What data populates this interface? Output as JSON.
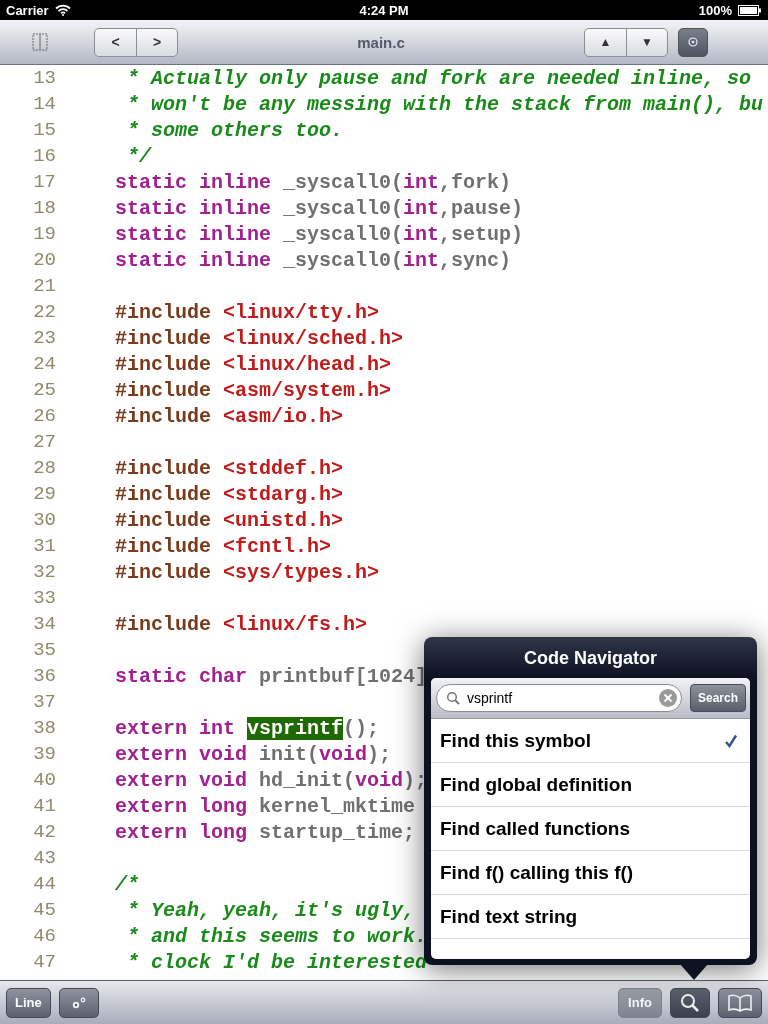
{
  "status_bar": {
    "carrier": "Carrier",
    "time": "4:24 PM",
    "battery": "100%"
  },
  "nav_bar": {
    "title": "main.c",
    "history_buttons": [
      "<",
      ">"
    ],
    "scroll_buttons": [
      "▲",
      "▼"
    ],
    "target_button_selected": true
  },
  "code_lines": [
    {
      "number": "13",
      "tokens": [
        {
          "kind": "comment",
          "text": " * Actually only pause and fork are needed inline, so"
        }
      ]
    },
    {
      "number": "14",
      "tokens": [
        {
          "kind": "comment",
          "text": " * won't be any messing with the stack from main(), bu"
        }
      ]
    },
    {
      "number": "15",
      "tokens": [
        {
          "kind": "comment",
          "text": " * some others too."
        }
      ]
    },
    {
      "number": "16",
      "tokens": [
        {
          "kind": "comment",
          "text": " */"
        }
      ]
    },
    {
      "number": "17",
      "tokens": [
        {
          "kind": "keyword",
          "text": "static inline "
        },
        {
          "kind": "plain",
          "text": "_syscall0("
        },
        {
          "kind": "keyword",
          "text": "int"
        },
        {
          "kind": "plain",
          "text": ",fork)"
        }
      ]
    },
    {
      "number": "18",
      "tokens": [
        {
          "kind": "keyword",
          "text": "static inline "
        },
        {
          "kind": "plain",
          "text": "_syscall0("
        },
        {
          "kind": "keyword",
          "text": "int"
        },
        {
          "kind": "plain",
          "text": ",pause)"
        }
      ]
    },
    {
      "number": "19",
      "tokens": [
        {
          "kind": "keyword",
          "text": "static inline "
        },
        {
          "kind": "plain",
          "text": "_syscall0("
        },
        {
          "kind": "keyword",
          "text": "int"
        },
        {
          "kind": "plain",
          "text": ",setup)"
        }
      ]
    },
    {
      "number": "20",
      "tokens": [
        {
          "kind": "keyword",
          "text": "static inline "
        },
        {
          "kind": "plain",
          "text": "_syscall0("
        },
        {
          "kind": "keyword",
          "text": "int"
        },
        {
          "kind": "plain",
          "text": ",sync)"
        }
      ]
    },
    {
      "number": "21"
    },
    {
      "number": "22",
      "tokens": [
        {
          "kind": "directive",
          "text": "#include "
        },
        {
          "kind": "header",
          "text": "<linux/tty.h>"
        }
      ]
    },
    {
      "number": "23",
      "tokens": [
        {
          "kind": "directive",
          "text": "#include "
        },
        {
          "kind": "header",
          "text": "<linux/sched.h>"
        }
      ]
    },
    {
      "number": "24",
      "tokens": [
        {
          "kind": "directive",
          "text": "#include "
        },
        {
          "kind": "header",
          "text": "<linux/head.h>"
        }
      ]
    },
    {
      "number": "25",
      "tokens": [
        {
          "kind": "directive",
          "text": "#include "
        },
        {
          "kind": "header",
          "text": "<asm/system.h>"
        }
      ]
    },
    {
      "number": "26",
      "tokens": [
        {
          "kind": "directive",
          "text": "#include "
        },
        {
          "kind": "header",
          "text": "<asm/io.h>"
        }
      ]
    },
    {
      "number": "27"
    },
    {
      "number": "28",
      "tokens": [
        {
          "kind": "directive",
          "text": "#include "
        },
        {
          "kind": "header",
          "text": "<stddef.h>"
        }
      ]
    },
    {
      "number": "29",
      "tokens": [
        {
          "kind": "directive",
          "text": "#include "
        },
        {
          "kind": "header",
          "text": "<stdarg.h>"
        }
      ]
    },
    {
      "number": "30",
      "tokens": [
        {
          "kind": "directive",
          "text": "#include "
        },
        {
          "kind": "header",
          "text": "<unistd.h>"
        }
      ]
    },
    {
      "number": "31",
      "tokens": [
        {
          "kind": "directive",
          "text": "#include "
        },
        {
          "kind": "header",
          "text": "<fcntl.h>"
        }
      ]
    },
    {
      "number": "32",
      "tokens": [
        {
          "kind": "directive",
          "text": "#include "
        },
        {
          "kind": "header",
          "text": "<sys/types.h>"
        }
      ]
    },
    {
      "number": "33"
    },
    {
      "number": "34",
      "tokens": [
        {
          "kind": "directive",
          "text": "#include "
        },
        {
          "kind": "header",
          "text": "<linux/fs.h>"
        }
      ]
    },
    {
      "number": "35"
    },
    {
      "number": "36",
      "tokens": [
        {
          "kind": "keyword",
          "text": "static char "
        },
        {
          "kind": "plain",
          "text": "printbuf[1024]"
        }
      ]
    },
    {
      "number": "37"
    },
    {
      "number": "38",
      "tokens": [
        {
          "kind": "keyword",
          "text": "extern int "
        },
        {
          "kind": "match",
          "text": "vsprintf"
        },
        {
          "kind": "plain",
          "text": "();"
        }
      ]
    },
    {
      "number": "39",
      "tokens": [
        {
          "kind": "keyword",
          "text": "extern void "
        },
        {
          "kind": "plain",
          "text": "init("
        },
        {
          "kind": "keyword",
          "text": "void"
        },
        {
          "kind": "plain",
          "text": ");"
        }
      ]
    },
    {
      "number": "40",
      "tokens": [
        {
          "kind": "keyword",
          "text": "extern void "
        },
        {
          "kind": "plain",
          "text": "hd_init("
        },
        {
          "kind": "keyword",
          "text": "void"
        },
        {
          "kind": "plain",
          "text": ");"
        }
      ]
    },
    {
      "number": "41",
      "tokens": [
        {
          "kind": "keyword",
          "text": "extern long "
        },
        {
          "kind": "plain",
          "text": "kernel_mktime"
        }
      ]
    },
    {
      "number": "42",
      "tokens": [
        {
          "kind": "keyword",
          "text": "extern long "
        },
        {
          "kind": "plain",
          "text": "startup_time;"
        }
      ]
    },
    {
      "number": "43"
    },
    {
      "number": "44",
      "tokens": [
        {
          "kind": "comment",
          "text": "/*"
        }
      ]
    },
    {
      "number": "45",
      "tokens": [
        {
          "kind": "comment",
          "text": " * Yeah, yeah, it's ugly,"
        }
      ]
    },
    {
      "number": "46",
      "tokens": [
        {
          "kind": "comment",
          "text": " * and this seems to work."
        }
      ]
    },
    {
      "number": "47",
      "tokens": [
        {
          "kind": "comment",
          "text": " * clock I'd be interested"
        }
      ]
    }
  ],
  "popover": {
    "title": "Code Navigator",
    "search_value": "vsprintf",
    "search_button": "Search",
    "options": [
      {
        "label": "Find this symbol",
        "selected": true
      },
      {
        "label": "Find global definition",
        "selected": false
      },
      {
        "label": "Find called functions",
        "selected": false
      },
      {
        "label": "Find f() calling this f()",
        "selected": false
      },
      {
        "label": "Find text string",
        "selected": false
      }
    ]
  },
  "toolbar": {
    "line_button": "Line",
    "info_button": {
      "label": "Info",
      "disabled": true
    },
    "search_selected": true
  }
}
